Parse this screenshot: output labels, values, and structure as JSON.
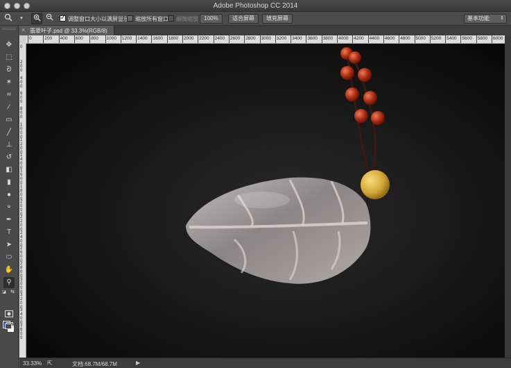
{
  "window": {
    "title": "Adobe Photoshop CC 2014"
  },
  "options_bar": {
    "resize_windows_label": "调整窗口大小以满屏显示",
    "resize_windows_checked": true,
    "zoom_all_label": "缩放所有窗口",
    "zoom_all_checked": false,
    "scrubby_zoom_label": "细微缩放",
    "scrubby_zoom_checked": false,
    "percent_button": "100%",
    "fit_screen_button": "适合屏幕",
    "fill_screen_button": "填充屏幕",
    "workspace_select": "基本功能",
    "icons": [
      "zoom-tool-icon",
      "chevron-down-icon",
      "zoom-in-icon",
      "zoom-out-icon"
    ]
  },
  "document_tab": {
    "title": "翡翠叶子.psd @ 33.3%(RGB/8)"
  },
  "ruler": {
    "h_labels": [
      "0",
      "200",
      "400",
      "600",
      "800",
      "1000",
      "1200",
      "1400",
      "1600",
      "1800",
      "2000",
      "2200",
      "2400",
      "2600",
      "2800",
      "3000",
      "3200",
      "3400",
      "3600",
      "3800",
      "4000",
      "4200",
      "4400",
      "4600",
      "4800",
      "5000",
      "5200",
      "5400",
      "5600",
      "5800",
      "6000"
    ],
    "v_labels": [
      "0",
      "2\n0\n0",
      "4\n0\n0",
      "6\n0\n0",
      "8\n0\n0",
      "1\n0\n0\n0",
      "1\n2\n0\n0",
      "1\n4\n0\n0",
      "1\n6\n0\n0",
      "1\n8\n0\n0",
      "2\n0\n0\n0",
      "2\n2\n0\n0",
      "2\n4\n0\n0",
      "2\n6\n0\n0",
      "2\n8\n0\n0",
      "3\n0\n0\n0",
      "3\n2\n0\n0",
      "3\n4\n0\n0",
      "3\n6\n0\n0"
    ]
  },
  "tools": [
    {
      "name": "move-tool-icon",
      "glyph": "✥"
    },
    {
      "name": "marquee-tool-icon",
      "glyph": "⬚"
    },
    {
      "name": "lasso-tool-icon",
      "glyph": "ᘐ"
    },
    {
      "name": "magic-wand-tool-icon",
      "glyph": "✶"
    },
    {
      "name": "crop-tool-icon",
      "glyph": "⌗"
    },
    {
      "name": "eyedropper-tool-icon",
      "glyph": "⁄"
    },
    {
      "name": "healing-brush-tool-icon",
      "glyph": "▭"
    },
    {
      "name": "brush-tool-icon",
      "glyph": "╱"
    },
    {
      "name": "clone-stamp-tool-icon",
      "glyph": "⊥"
    },
    {
      "name": "history-brush-tool-icon",
      "glyph": "↺"
    },
    {
      "name": "eraser-tool-icon",
      "glyph": "◧"
    },
    {
      "name": "gradient-tool-icon",
      "glyph": "▮"
    },
    {
      "name": "blur-tool-icon",
      "glyph": "●"
    },
    {
      "name": "dodge-tool-icon",
      "glyph": "⚬"
    },
    {
      "name": "pen-tool-icon",
      "glyph": "✒"
    },
    {
      "name": "type-tool-icon",
      "glyph": "T"
    },
    {
      "name": "path-selection-tool-icon",
      "glyph": "➤"
    },
    {
      "name": "ellipse-tool-icon",
      "glyph": "⬭"
    },
    {
      "name": "hand-tool-icon",
      "glyph": "✋"
    },
    {
      "name": "zoom-tool-icon",
      "glyph": "⚲"
    }
  ],
  "colors": {
    "foreground": "#2b61bd",
    "background": "#ffffff"
  },
  "status_bar": {
    "zoom": "33.33%",
    "doc_size": "文档:68.7M/68.7M"
  }
}
